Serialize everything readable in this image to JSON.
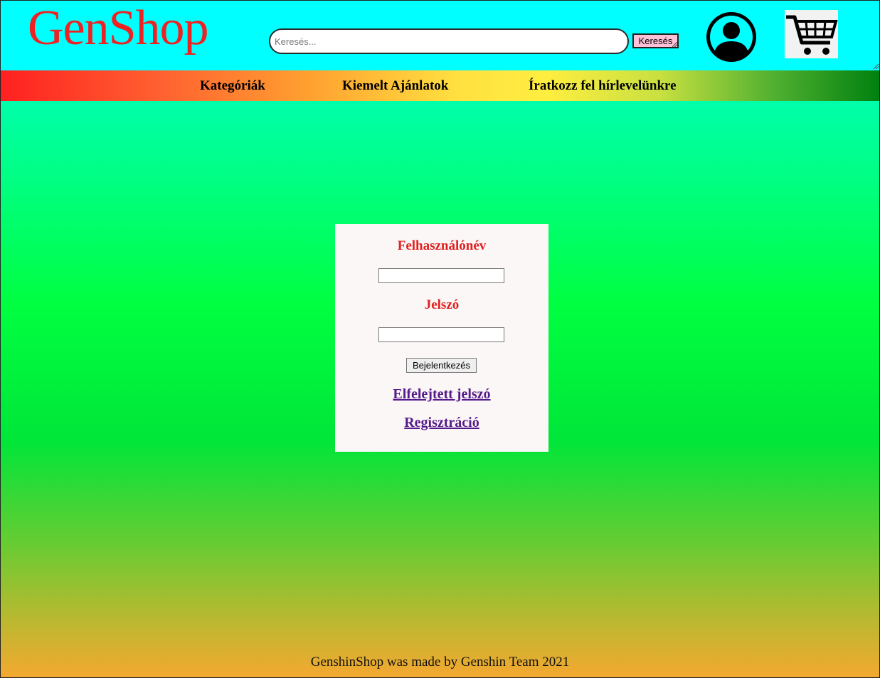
{
  "header": {
    "logo": "GenShop",
    "search": {
      "placeholder": "Keresés...",
      "value": "",
      "button_label": "Keresés"
    },
    "user_icon": "user-avatar-icon",
    "cart_icon": "shopping-cart-icon"
  },
  "nav": {
    "items": [
      {
        "label": "Kategóriák"
      },
      {
        "label": "Kiemelt Ajánlatok"
      },
      {
        "label": "Íratkozz fel hírlevelünkre"
      }
    ]
  },
  "login": {
    "username_label": "Felhasználónév",
    "username_value": "",
    "password_label": "Jelszó",
    "password_value": "",
    "submit_label": "Bejelentkezés",
    "forgot_link": "Elfelejtett jelszó",
    "register_link": "Regisztráció"
  },
  "footer": {
    "text": "GenshinShop was made by Genshin Team 2021"
  },
  "colors": {
    "header_bg": "#00ffff",
    "logo": "#ee2222",
    "label": "#e02020",
    "link_visited": "#551a8b",
    "search_button_bg": "#ffc0d8",
    "login_box_bg": "#fbf7f6"
  }
}
